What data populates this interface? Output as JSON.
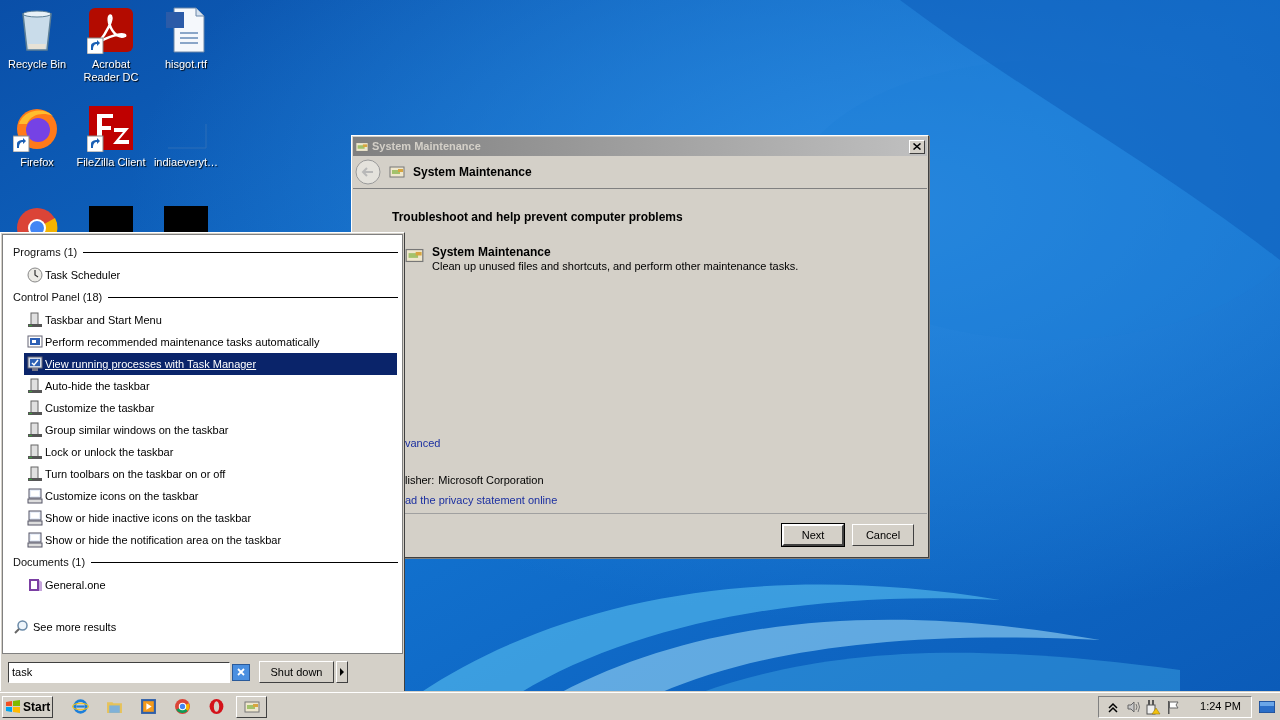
{
  "desktop_icons": [
    {
      "label": "Recycle Bin",
      "kind": "recycle",
      "shortcut": false
    },
    {
      "label": "Acrobat Reader DC",
      "kind": "acrobat",
      "shortcut": true
    },
    {
      "label": "hisgot.rtf",
      "kind": "word",
      "shortcut": false
    },
    {
      "label": "Firefox",
      "kind": "firefox",
      "shortcut": true
    },
    {
      "label": "FileZilla Client",
      "kind": "filezilla",
      "shortcut": true
    },
    {
      "label": "indiaeveryt…",
      "kind": "blank",
      "shortcut": false
    },
    {
      "kind": "chrome"
    },
    {
      "kind": "dark"
    },
    {
      "kind": "dark"
    }
  ],
  "dialog": {
    "title": "System Maintenance",
    "header": "System Maintenance",
    "heading": "Troubleshoot and help prevent computer problems",
    "task": {
      "title": "System Maintenance",
      "description": "Clean up unused files and shortcuts, and perform other maintenance tasks."
    },
    "advanced_link": "vanced",
    "publisher_label": "lisher:",
    "publisher": "Microsoft Corporation",
    "privacy_link": "ad the privacy statement online",
    "buttons": [
      {
        "label": "Next",
        "default": true
      },
      {
        "label": "Cancel",
        "default": false
      }
    ]
  },
  "start_menu": {
    "sections": [
      {
        "title": "Programs (1)",
        "items": [
          {
            "label": "Task Scheduler",
            "kind": "clock",
            "selected": false
          }
        ]
      },
      {
        "title": "Control Panel (18)",
        "items": [
          {
            "label": "Taskbar and Start Menu",
            "kind": "taskbar",
            "selected": false
          },
          {
            "label": "Perform recommended maintenance tasks automatically",
            "kind": "maintenance",
            "selected": false
          },
          {
            "label": "View running processes with Task Manager",
            "kind": "taskmgr",
            "selected": true
          },
          {
            "label": "Auto-hide the taskbar",
            "kind": "taskbar",
            "selected": false
          },
          {
            "label": "Customize the taskbar",
            "kind": "taskbar",
            "selected": false
          },
          {
            "label": "Group similar windows on the taskbar",
            "kind": "taskbar",
            "selected": false
          },
          {
            "label": "Lock or unlock the taskbar",
            "kind": "taskbar",
            "selected": false
          },
          {
            "label": "Turn toolbars on the taskbar on or off",
            "kind": "taskbar",
            "selected": false
          },
          {
            "label": "Customize icons on the taskbar",
            "kind": "monitor",
            "selected": false
          },
          {
            "label": "Show or hide inactive icons on the taskbar",
            "kind": "monitor",
            "selected": false
          },
          {
            "label": "Show or hide the notification area on the taskbar",
            "kind": "monitor",
            "selected": false
          }
        ]
      },
      {
        "title": "Documents (1)",
        "items": [
          {
            "label": "General.one",
            "kind": "onenote",
            "selected": false
          }
        ]
      }
    ],
    "see_more": "See more results",
    "search": {
      "value": "task"
    },
    "shutdown": "Shut down"
  },
  "taskbar": {
    "start": "Start",
    "quick_launch": [
      {
        "kind": "ie"
      },
      {
        "kind": "folder"
      },
      {
        "kind": "media"
      },
      {
        "kind": "chrome"
      },
      {
        "kind": "opera"
      }
    ],
    "tasks": [
      {
        "kind": "maintenance"
      }
    ],
    "tray": [
      {
        "kind": "chevron"
      },
      {
        "kind": "speaker"
      },
      {
        "kind": "network"
      },
      {
        "kind": "flag"
      }
    ],
    "clock": "1:24 PM"
  }
}
